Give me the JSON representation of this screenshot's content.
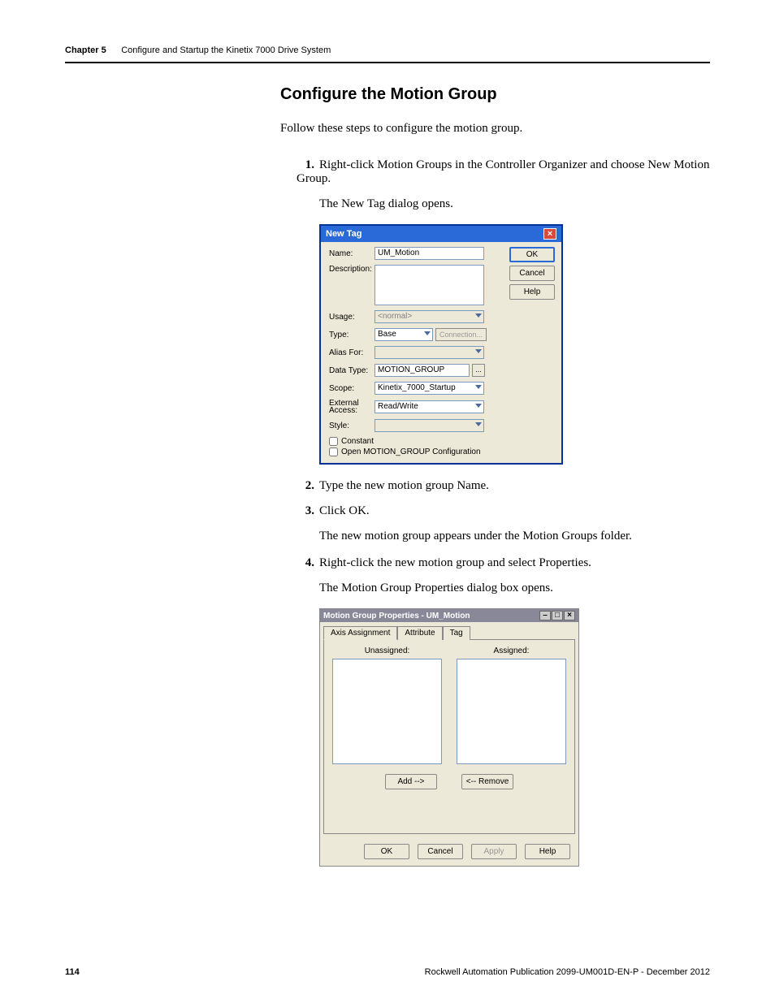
{
  "header": {
    "chapter": "Chapter 5",
    "title": "Configure and Startup the Kinetix 7000 Drive System"
  },
  "section_title": "Configure the Motion Group",
  "intro": "Follow these steps to configure the motion group.",
  "steps": {
    "s1_num": "1.",
    "s1": "Right-click Motion Groups in the Controller Organizer and choose New Motion Group.",
    "s1_sub": "The New Tag dialog opens.",
    "s2_num": "2.",
    "s2": "Type the new motion group Name.",
    "s3_num": "3.",
    "s3": "Click OK.",
    "s3_sub": "The new motion group appears under the Motion Groups folder.",
    "s4_num": "4.",
    "s4": "Right-click the new motion group and select Properties.",
    "s4_sub": "The Motion Group Properties dialog box opens."
  },
  "dialog1": {
    "title": "New Tag",
    "name_label": "Name:",
    "name_value": "UM_Motion",
    "desc_label": "Description:",
    "usage_label": "Usage:",
    "usage_value": "<normal>",
    "type_label": "Type:",
    "type_value": "Base",
    "conn_button": "Connection...",
    "alias_label": "Alias For:",
    "datatype_label": "Data Type:",
    "datatype_value": "MOTION_GROUP",
    "ellipsis": "...",
    "scope_label": "Scope:",
    "scope_value": "Kinetix_7000_Startup",
    "ext_label": "External Access:",
    "ext_value": "Read/Write",
    "style_label": "Style:",
    "chk1": "Constant",
    "chk2": "Open MOTION_GROUP Configuration",
    "ok": "OK",
    "cancel": "Cancel",
    "help": "Help"
  },
  "dialog2": {
    "title": "Motion Group Properties - UM_Motion",
    "tabs": {
      "t1": "Axis Assignment",
      "t2": "Attribute",
      "t3": "Tag"
    },
    "unassigned": "Unassigned:",
    "assigned": "Assigned:",
    "add": "Add -->",
    "remove": "<-- Remove",
    "ok": "OK",
    "cancel": "Cancel",
    "apply": "Apply",
    "help": "Help"
  },
  "footer": {
    "page": "114",
    "pub": "Rockwell Automation Publication 2099-UM001D-EN-P - December 2012"
  }
}
